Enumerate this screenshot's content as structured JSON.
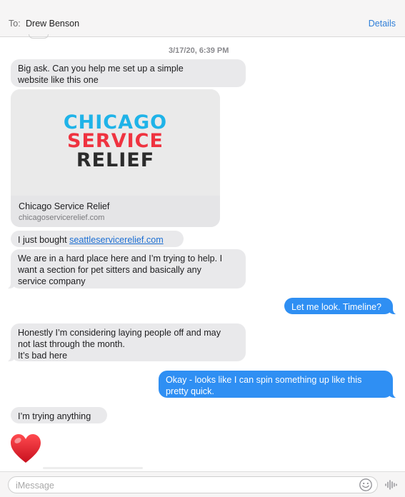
{
  "header": {
    "to_label": "To:",
    "recipient": "Drew Benson",
    "details_label": "Details"
  },
  "timestamp": "3/17/20, 6:39 PM",
  "messages": [
    {
      "direction": "incoming",
      "text": "Big ask. Can you help me set up a simple\nwebsite  like this one"
    },
    {
      "direction": "incoming",
      "type": "link-preview",
      "logo_lines": [
        "CHICAGO",
        "SERVICE",
        "RELIEF"
      ],
      "title": "Chicago Service Relief",
      "url": "chicagoservicerelief.com"
    },
    {
      "direction": "incoming",
      "prefix": "I just bought ",
      "link": "seattleservicerelief.com"
    },
    {
      "direction": "incoming",
      "text": "We are in a hard place here and I’m trying to help. I\nwant a section for pet sitters and basically any\nservice company"
    },
    {
      "direction": "outgoing",
      "text": "Let me look. Timeline?"
    },
    {
      "direction": "incoming",
      "text": "Honestly I’m considering laying people off and may\nnot last through the month.\nIt’s bad here"
    },
    {
      "direction": "outgoing",
      "text": "Okay - looks like I can spin something up like this\npretty quick."
    },
    {
      "direction": "incoming",
      "text": "I’m trying anything"
    },
    {
      "direction": "incoming",
      "type": "emoji",
      "emoji": "heart"
    }
  ],
  "composer": {
    "placeholder": "iMessage",
    "emoji_icon": "emoji-face-icon",
    "voice_icon": "audio-waveform-icon"
  },
  "colors": {
    "outgoing_bubble": "#2f8ff3",
    "incoming_bubble": "#e9e9eb",
    "link": "#1d6fd3",
    "details": "#2f7fd8",
    "logo_blue": "#1fb3e8",
    "logo_red": "#ef3340",
    "logo_dark": "#2c2c2c",
    "heart": "#e0202a"
  }
}
